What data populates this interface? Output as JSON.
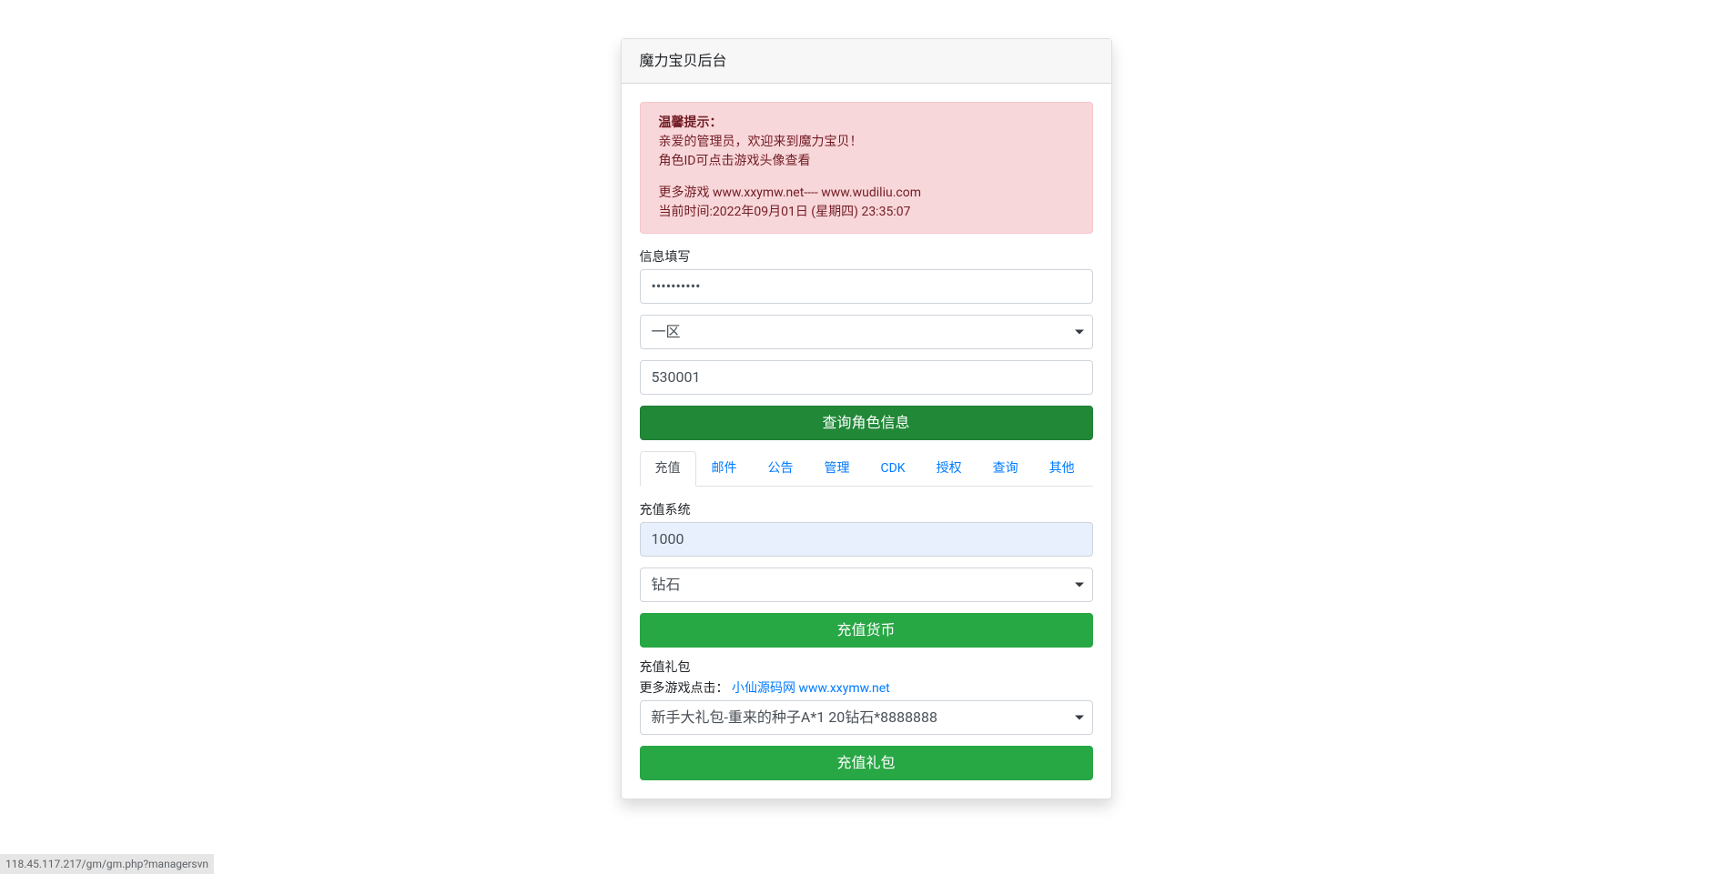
{
  "header": {
    "title": "魔力宝贝后台"
  },
  "alert": {
    "heading": "温馨提示：",
    "line1": "亲爱的管理员，欢迎来到魔力宝贝！",
    "line2": "角色ID可点击游戏头像查看",
    "line3": "更多游戏 www.xxymw.net---- www.wudiliu.com",
    "line4": "当前时间:2022年09月01日 (星期四) 23:35:07"
  },
  "info_form": {
    "label": "信息填写",
    "password_value": "••••••••••",
    "region_selected": "一区",
    "character_id": "530001",
    "query_button_label": "查询角色信息"
  },
  "tabs": [
    {
      "label": "充值",
      "name": "recharge",
      "active": true
    },
    {
      "label": "邮件",
      "name": "mail",
      "active": false
    },
    {
      "label": "公告",
      "name": "announcement",
      "active": false
    },
    {
      "label": "管理",
      "name": "manage",
      "active": false
    },
    {
      "label": "CDK",
      "name": "cdk",
      "active": false
    },
    {
      "label": "授权",
      "name": "authorize",
      "active": false
    },
    {
      "label": "查询",
      "name": "query",
      "active": false
    },
    {
      "label": "其他",
      "name": "other",
      "active": false
    }
  ],
  "recharge_currency": {
    "label": "充值系统",
    "amount_value": "1000",
    "currency_selected": "钻石",
    "submit_label": "充值货币"
  },
  "recharge_pack": {
    "label": "充值礼包",
    "more_games_prefix": "更多游戏点击：",
    "more_games_link": "小仙源码网 www.xxymw.net",
    "pack_selected": "新手大礼包-重来的种子A*1 20钻石*8888888",
    "submit_label": "充值礼包"
  },
  "status_url": "118.45.117.217/gm/gm.php?managersvn"
}
